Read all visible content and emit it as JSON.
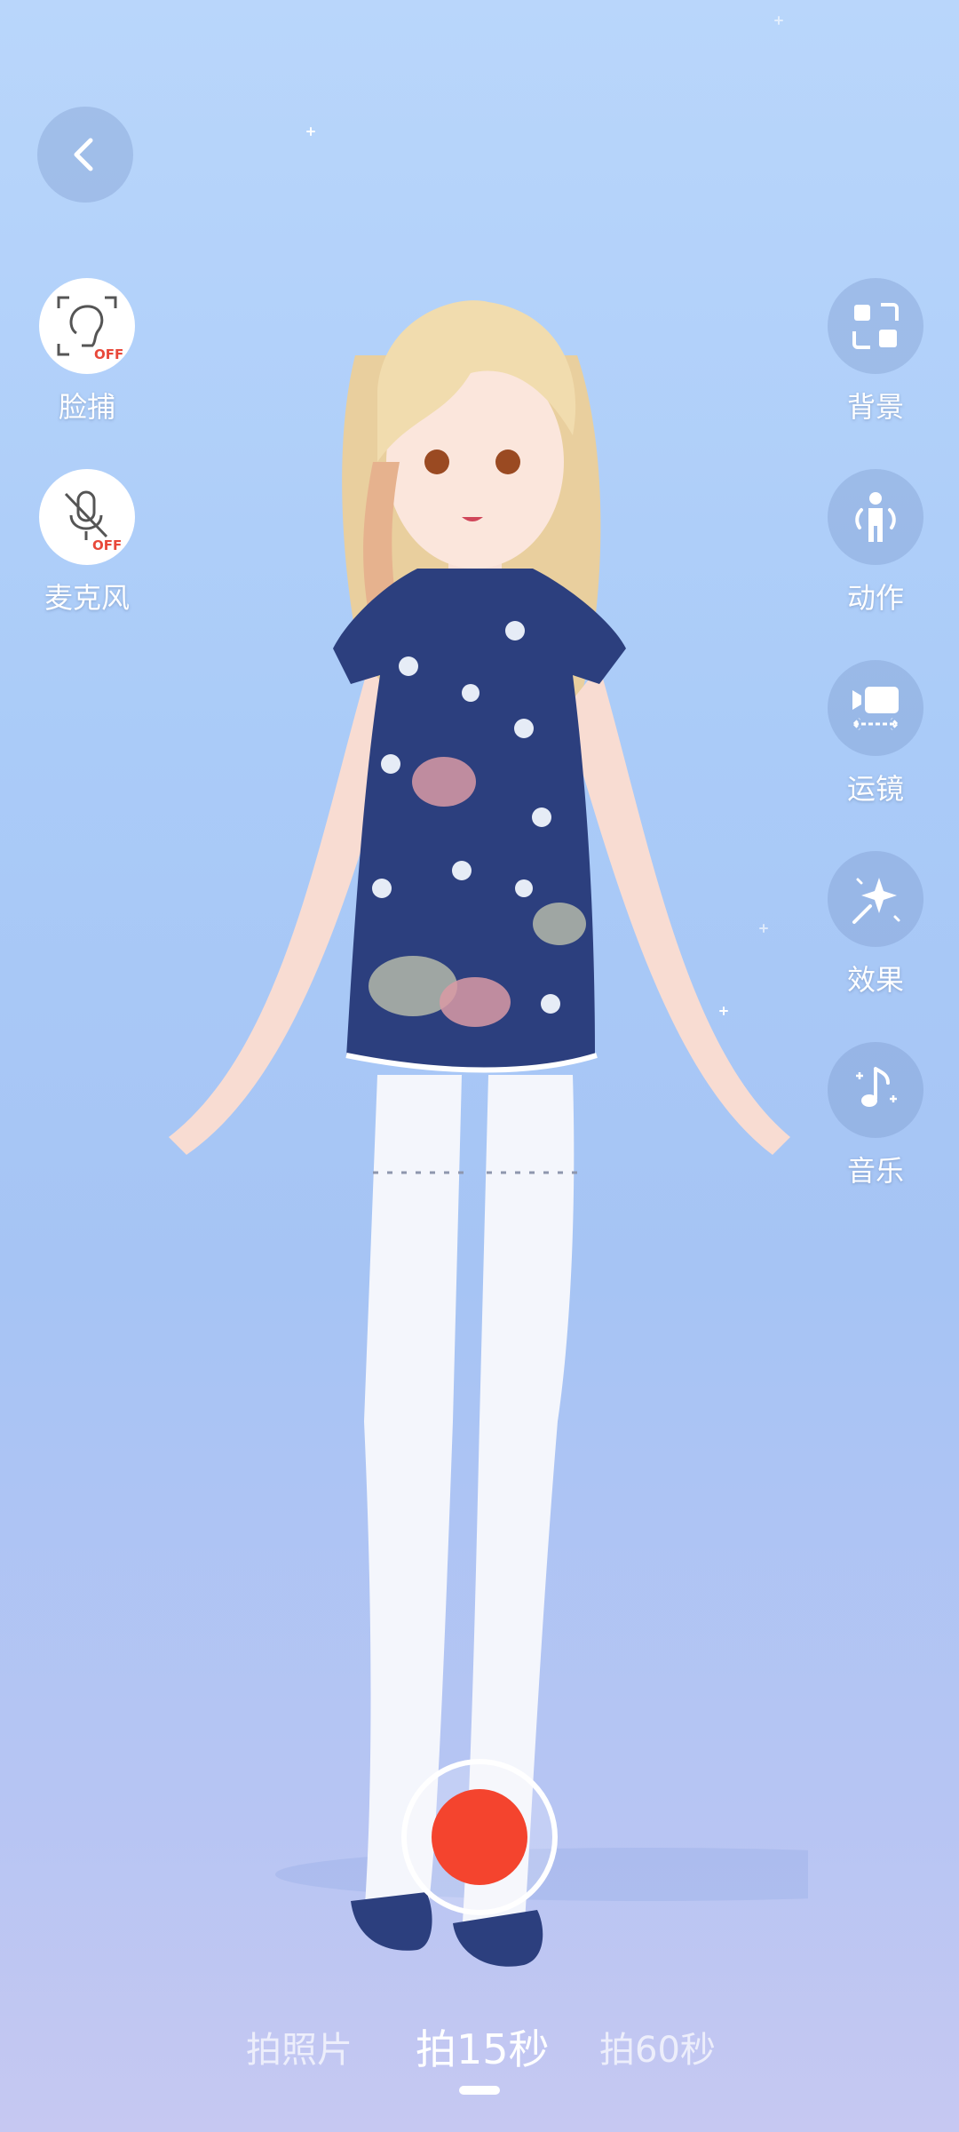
{
  "left_tools": [
    {
      "label": "脸捕",
      "icon": "face-capture-off-icon",
      "badge": "OFF"
    },
    {
      "label": "麦克风",
      "icon": "microphone-off-icon",
      "badge": "OFF"
    }
  ],
  "right_tools": [
    {
      "label": "背景",
      "icon": "background-grid-icon"
    },
    {
      "label": "动作",
      "icon": "person-action-icon"
    },
    {
      "label": "运镜",
      "icon": "camera-movement-icon"
    },
    {
      "label": "效果",
      "icon": "sparkle-effect-icon"
    },
    {
      "label": "音乐",
      "icon": "music-note-icon"
    }
  ],
  "modes": [
    {
      "label": "拍照片"
    },
    {
      "label": "拍15秒"
    },
    {
      "label": "拍60秒"
    }
  ],
  "active_mode": "拍15秒",
  "colors": {
    "record": "#f4442e",
    "off_badge": "#e8483a",
    "dress": "#2c3f7e"
  }
}
